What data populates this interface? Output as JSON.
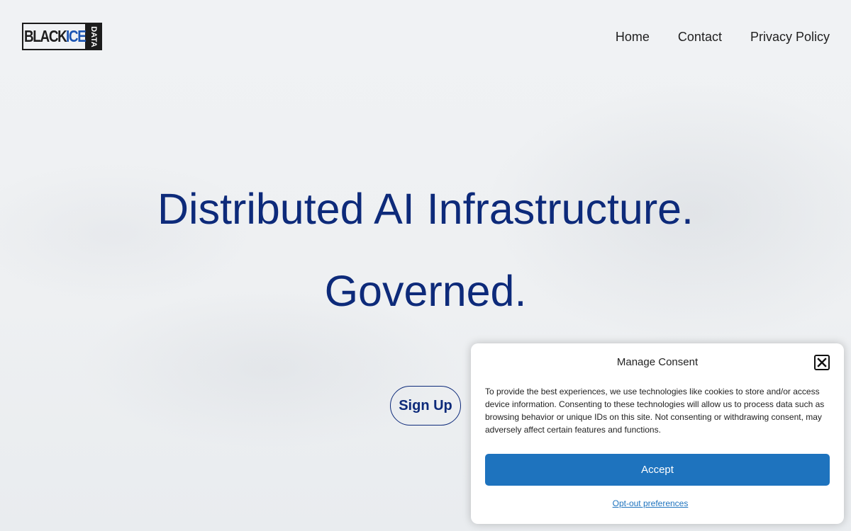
{
  "brand": {
    "logo_main_black": "BLACK",
    "logo_main_ice": "ICE",
    "logo_side": "DATA",
    "accent_color": "#1b55b3"
  },
  "nav": {
    "items": [
      {
        "label": "Home"
      },
      {
        "label": "Contact"
      },
      {
        "label": "Privacy Policy"
      }
    ]
  },
  "hero": {
    "line1": "Distributed AI Infrastructure.",
    "line2": "Governed.",
    "cta_label": "Sign Up",
    "text_color": "#0d2a7a"
  },
  "consent": {
    "title": "Manage Consent",
    "close_icon": "close-icon",
    "body": "To provide the best experiences, we use technologies like cookies to store and/or access device information. Consenting to these technologies will allow us to process data such as browsing behavior or unique IDs on this site. Not consenting or withdrawing consent, may adversely affect certain features and functions.",
    "accept_label": "Accept",
    "optout_label": "Opt-out preferences",
    "accept_color": "#1e73be"
  }
}
